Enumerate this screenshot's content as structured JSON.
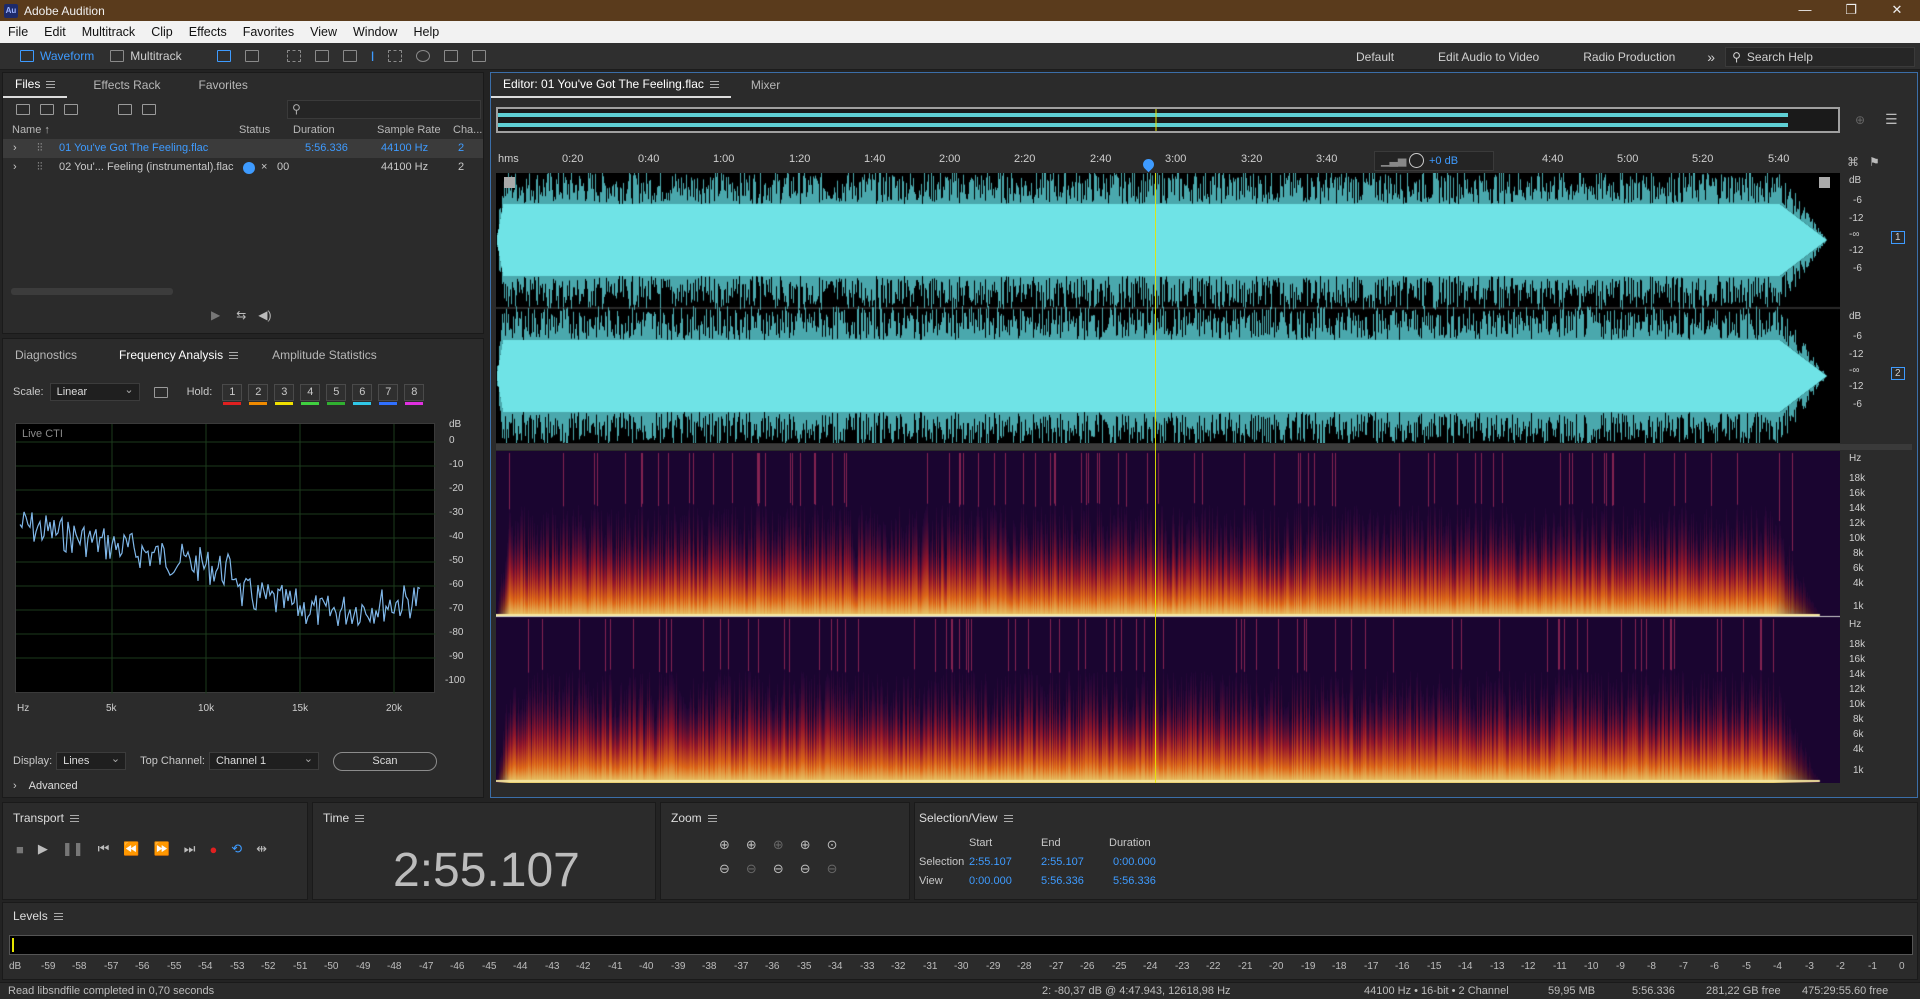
{
  "app": {
    "title": "Adobe Audition",
    "logo": "Au"
  },
  "window_controls": [
    "—",
    "❐",
    "✕"
  ],
  "menu": [
    "File",
    "Edit",
    "Multitrack",
    "Clip",
    "Effects",
    "Favorites",
    "View",
    "Window",
    "Help"
  ],
  "toolbar": {
    "waveform": "Waveform",
    "multitrack": "Multitrack",
    "workspaces": [
      "Default",
      "Edit Audio to Video",
      "Radio Production"
    ],
    "more": "»",
    "search_placeholder": "Search Help"
  },
  "files_panel": {
    "tabs": [
      "Files",
      "Effects Rack",
      "Favorites"
    ],
    "columns": [
      "Name ↑",
      "Status",
      "Duration",
      "Sample Rate",
      "Cha..."
    ],
    "rows": [
      {
        "name": "01 You've Got The Feeling.flac",
        "status": "",
        "duration": "5:56.336",
        "sample_rate": "44100 Hz",
        "channels": "2"
      },
      {
        "name": "02 You'... Feeling (instrumental).flac",
        "status": "×",
        "duration": "00",
        "sample_rate": "44100 Hz",
        "channels": "2"
      }
    ]
  },
  "analysis_panel": {
    "tabs": [
      "Diagnostics",
      "Frequency Analysis",
      "Amplitude Statistics"
    ],
    "scale_label": "Scale:",
    "scale_value": "Linear",
    "hold_label": "Hold:",
    "holds": [
      "1",
      "2",
      "3",
      "4",
      "5",
      "6",
      "7",
      "8"
    ],
    "hold_colors": [
      "#e02020",
      "#f08a00",
      "#f0e000",
      "#40d040",
      "#30b030",
      "#30c8e8",
      "#3070ff",
      "#e030e0"
    ],
    "graph_label": "Live CTI",
    "db_label": "dB",
    "db_ticks": [
      "0",
      "-10",
      "-20",
      "-30",
      "-40",
      "-50",
      "-60",
      "-70",
      "-80",
      "-90",
      "-100"
    ],
    "hz_ticks": [
      "Hz",
      "5k",
      "10k",
      "15k",
      "20k"
    ],
    "display_label": "Display:",
    "display_value": "Lines",
    "top_channel_label": "Top Channel:",
    "top_channel_value": "Channel 1",
    "scan_label": "Scan",
    "advanced_label": "Advanced"
  },
  "editor": {
    "tabs": [
      "Editor: 01 You've Got The Feeling.flac",
      "Mixer"
    ],
    "ruler_unit": "hms",
    "ruler_ticks": [
      "0:20",
      "0:40",
      "1:00",
      "1:20",
      "1:40",
      "2:00",
      "2:20",
      "2:40",
      "3:00",
      "3:20",
      "3:40",
      "4:40",
      "5:00",
      "5:20",
      "5:40"
    ],
    "gain": "+0 dB",
    "db_scale_label": "dB",
    "db_scale": [
      "-6",
      "-12",
      "-∞",
      "-12",
      "-6"
    ],
    "channels": [
      "1",
      "2"
    ],
    "hz_label": "Hz",
    "hz_scale": [
      "18k",
      "16k",
      "14k",
      "12k",
      "10k",
      "8k",
      "6k",
      "4k",
      "1k"
    ]
  },
  "transport": {
    "title": "Transport"
  },
  "time_panel": {
    "title": "Time",
    "value": "2:55.107"
  },
  "zoom_panel": {
    "title": "Zoom"
  },
  "selection_panel": {
    "title": "Selection/View",
    "headers": [
      "Start",
      "End",
      "Duration"
    ],
    "selection_label": "Selection",
    "selection": [
      "2:55.107",
      "2:55.107",
      "0:00.000"
    ],
    "view_label": "View",
    "view": [
      "0:00.000",
      "5:56.336",
      "5:56.336"
    ]
  },
  "levels": {
    "title": "Levels",
    "scale": [
      "dB",
      "-59",
      "-58",
      "-57",
      "-56",
      "-55",
      "-54",
      "-53",
      "-52",
      "-51",
      "-50",
      "-49",
      "-48",
      "-47",
      "-46",
      "-45",
      "-44",
      "-43",
      "-42",
      "-41",
      "-40",
      "-39",
      "-38",
      "-37",
      "-36",
      "-35",
      "-34",
      "-33",
      "-32",
      "-31",
      "-30",
      "-29",
      "-28",
      "-27",
      "-26",
      "-25",
      "-24",
      "-23",
      "-22",
      "-21",
      "-20",
      "-19",
      "-18",
      "-17",
      "-16",
      "-15",
      "-14",
      "-13",
      "-12",
      "-11",
      "-10",
      "-9",
      "-8",
      "-7",
      "-6",
      "-5",
      "-4",
      "-3",
      "-2",
      "-1",
      "0"
    ]
  },
  "status_bar": {
    "message": "Read libsndfile completed in 0,70 seconds",
    "cursor": "2: -80,37 dB @ 4:47.943, 12618,98 Hz",
    "format": "44100 Hz • 16-bit • 2 Channel",
    "size": "59,95 MB",
    "duration": "5:56.336",
    "free": "281,22 GB free",
    "free_time": "475:29:55.60 free"
  }
}
